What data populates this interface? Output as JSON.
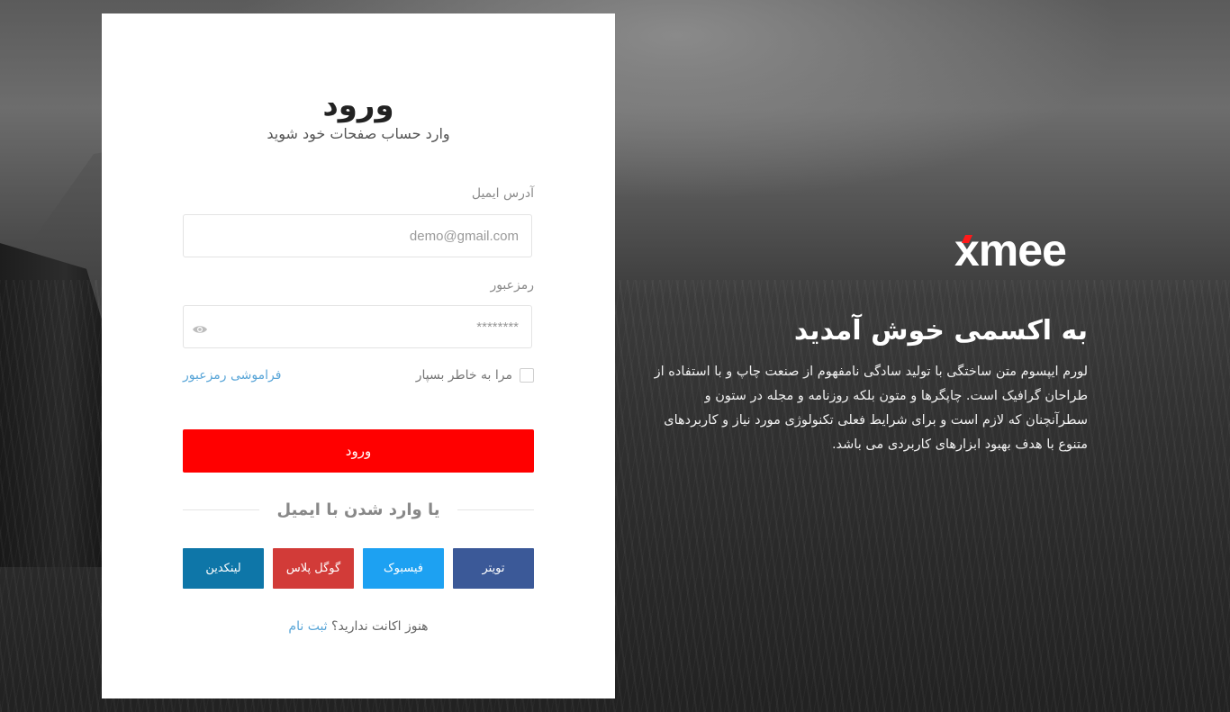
{
  "login": {
    "title": "ورود",
    "subtitle": "وارد حساب صفحات خود شوید",
    "email_label": "آدرس ایمیل",
    "email_placeholder": "demo@gmail.com",
    "password_label": "رمزعبور",
    "password_placeholder": "********",
    "remember_label": "مرا به خاطر بسپار",
    "forgot_link": "فراموشی رمزعبور",
    "submit_label": "ورود",
    "divider_text": "یا وارد شدن با ایمیل",
    "social": [
      {
        "label": "تویتر",
        "color": "#3b5998"
      },
      {
        "label": "فیسبوک",
        "color": "#1da1f2"
      },
      {
        "label": "گوگل پلاس",
        "color": "#d23b38"
      },
      {
        "label": "لینکدین",
        "color": "#0e76a8"
      }
    ],
    "signup_prompt": "هنوز اکانت ندارید؟",
    "signup_link": "ثبت نام"
  },
  "brand": {
    "logo_text": "xmee",
    "accent_color": "#ff1a1a"
  },
  "welcome": {
    "title": "به اکسمی خوش آمدید",
    "text": "لورم ایپسوم متن ساختگی با تولید سادگی نامفهوم از صنعت چاپ و با استفاده از طراحان گرافیک است. چاپگرها و متون بلکه روزنامه و مجله در ستون و سطرآنچنان که لازم است و برای شرایط فعلی تکنولوژی مورد نیاز و کاربردهای متنوع با هدف بهبود ابزارهای کاربردی می باشد."
  }
}
